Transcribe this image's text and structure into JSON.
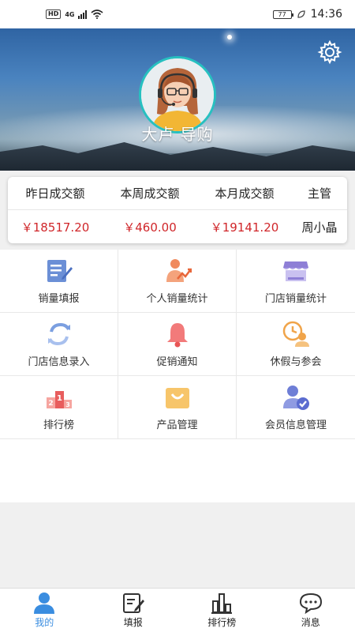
{
  "status_bar": {
    "hd": "HD",
    "network": "4G",
    "battery": "77",
    "time": "14:36"
  },
  "profile": {
    "name": "大卢 导购"
  },
  "sales": {
    "headers": [
      "昨日成交额",
      "本周成交额",
      "本月成交额",
      "主管"
    ],
    "values": [
      "￥18517.20",
      "￥460.00",
      "￥19141.20",
      "周小晶"
    ]
  },
  "menu": [
    {
      "label": "销量填报",
      "icon": "edit-form-icon"
    },
    {
      "label": "个人销量统计",
      "icon": "personal-stats-icon"
    },
    {
      "label": "门店销量统计",
      "icon": "store-icon"
    },
    {
      "label": "门店信息录入",
      "icon": "sync-arrows-icon"
    },
    {
      "label": "促销通知",
      "icon": "bell-icon"
    },
    {
      "label": "休假与参会",
      "icon": "leave-clock-icon"
    },
    {
      "label": "排行榜",
      "icon": "podium-icon"
    },
    {
      "label": "产品管理",
      "icon": "shopping-bag-icon"
    },
    {
      "label": "会员信息管理",
      "icon": "member-check-icon"
    }
  ],
  "nav": [
    {
      "label": "我的",
      "icon": "person-icon",
      "active": true
    },
    {
      "label": "填报",
      "icon": "edit-icon",
      "active": false
    },
    {
      "label": "排行榜",
      "icon": "bar-chart-icon",
      "active": false
    },
    {
      "label": "消息",
      "icon": "chat-bubble-icon",
      "active": false
    }
  ],
  "colors": {
    "accent": "#3a8de0",
    "money": "#d0262a",
    "avatar_ring": "#27c0c0"
  }
}
